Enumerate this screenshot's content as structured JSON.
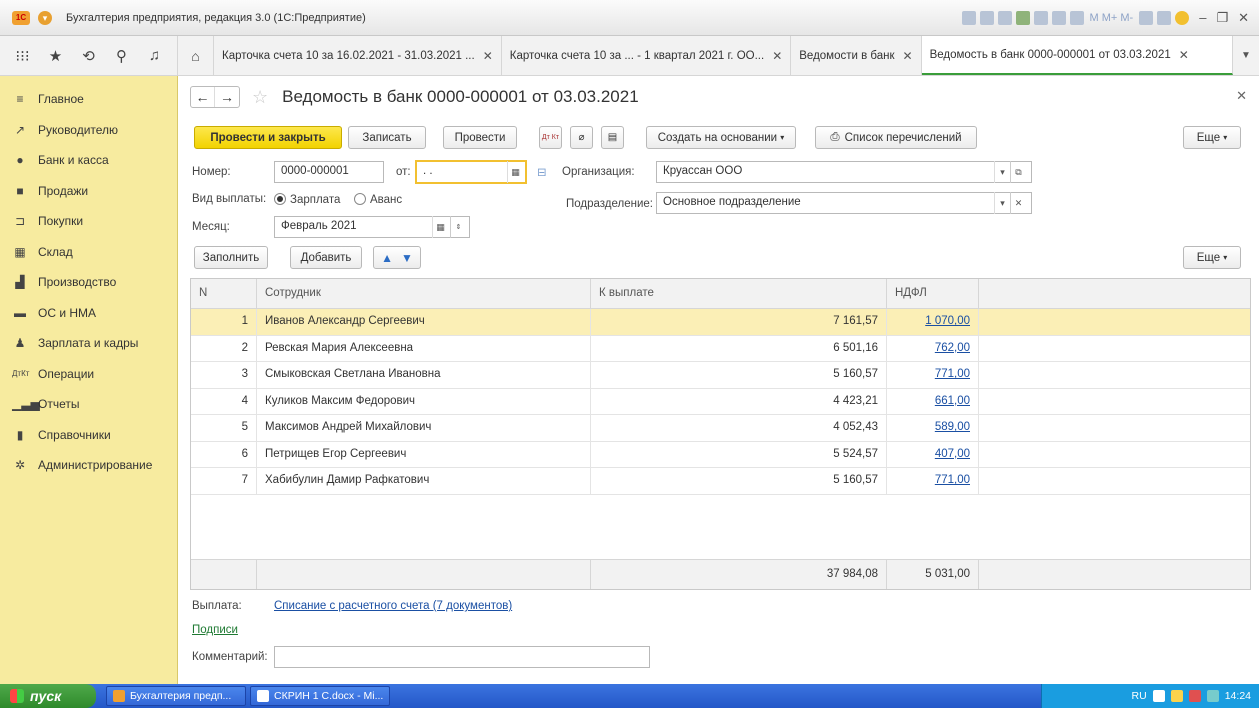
{
  "window": {
    "title": "Бухгалтерия предприятия, редакция 3.0 (1С:Предприятие)",
    "toolbar_text": "M M+ M-"
  },
  "tabs": [
    {
      "label": "Карточка счета 10 за 16.02.2021 - 31.03.2021 ..."
    },
    {
      "label": "Карточка счета 10 за ... - 1 квартал 2021 г. ОО..."
    },
    {
      "label": "Ведомости в банк"
    },
    {
      "label": "Ведомость в банк 0000-000001 от 03.03.2021"
    }
  ],
  "sidebar": {
    "items": [
      {
        "label": "Главное"
      },
      {
        "label": "Руководителю"
      },
      {
        "label": "Банк и касса"
      },
      {
        "label": "Продажи"
      },
      {
        "label": "Покупки"
      },
      {
        "label": "Склад"
      },
      {
        "label": "Производство"
      },
      {
        "label": "ОС и НМА"
      },
      {
        "label": "Зарплата и кадры"
      },
      {
        "label": "Операции"
      },
      {
        "label": "Отчеты"
      },
      {
        "label": "Справочники"
      },
      {
        "label": "Администрирование"
      }
    ]
  },
  "doc": {
    "title": "Ведомость в банк 0000-000001 от 03.03.2021",
    "btn_post_close": "Провести и закрыть",
    "btn_save": "Записать",
    "btn_post": "Провести",
    "btn_dtkt": "Дт Кт",
    "btn_create_base": "Создать на основании",
    "btn_transfer_list": "Список перечислений",
    "btn_more": "Еще",
    "number_label": "Номер:",
    "number_value": "0000-000001",
    "from_label": "от:",
    "date_value": "  .  .",
    "org_label": "Организация:",
    "org_value": "Круассан ООО",
    "payout_label": "Вид выплаты:",
    "payout_salary": "Зарплата",
    "payout_advance": "Аванс",
    "dept_label": "Подразделение:",
    "dept_value": "Основное подразделение",
    "month_label": "Месяц:",
    "month_value": "Февраль 2021",
    "btn_fill": "Заполнить",
    "btn_add": "Добавить",
    "btn_more2": "Еще",
    "payment_label": "Выплата:",
    "payment_link": "Списание с расчетного счета (7 документов)",
    "signatures_link": "Подписи",
    "comment_label": "Комментарий:",
    "comment_value": ""
  },
  "table": {
    "headers": {
      "n": "N",
      "employee": "Сотрудник",
      "pay": "К выплате",
      "ndfl": "НДФЛ"
    },
    "rows": [
      {
        "n": "1",
        "employee": "Иванов Александр Сергеевич",
        "pay": "7 161,57",
        "ndfl": "1 070,00"
      },
      {
        "n": "2",
        "employee": "Ревская Мария Алексеевна",
        "pay": "6 501,16",
        "ndfl": "762,00"
      },
      {
        "n": "3",
        "employee": "Смыковская Светлана Ивановна",
        "pay": "5 160,57",
        "ndfl": "771,00"
      },
      {
        "n": "4",
        "employee": "Куликов Максим Федорович",
        "pay": "4 423,21",
        "ndfl": "661,00"
      },
      {
        "n": "5",
        "employee": "Максимов Андрей Михайлович",
        "pay": "4 052,43",
        "ndfl": "589,00"
      },
      {
        "n": "6",
        "employee": "Петрищев Егор Сергеевич",
        "pay": "5 524,57",
        "ndfl": "407,00"
      },
      {
        "n": "7",
        "employee": "Хабибулин Дамир Рафкатович",
        "pay": "5 160,57",
        "ndfl": "771,00"
      }
    ],
    "total_pay": "37 984,08",
    "total_ndfl": "5 031,00"
  },
  "taskbar": {
    "start": "пуск",
    "tasks": [
      {
        "label": "Бухгалтерия предп..."
      },
      {
        "label": "СКРИН 1 С.docx - Mi..."
      }
    ],
    "lang": "RU",
    "time": "14:24"
  }
}
